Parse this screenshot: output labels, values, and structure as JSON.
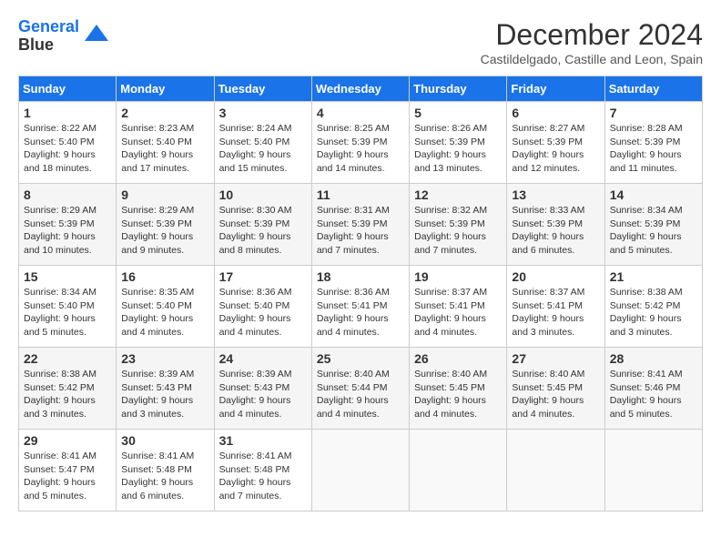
{
  "header": {
    "logo_line1": "General",
    "logo_line2": "Blue",
    "month_title": "December 2024",
    "location": "Castildelgado, Castille and Leon, Spain"
  },
  "weekdays": [
    "Sunday",
    "Monday",
    "Tuesday",
    "Wednesday",
    "Thursday",
    "Friday",
    "Saturday"
  ],
  "weeks": [
    [
      {
        "day": "1",
        "sunrise": "8:22 AM",
        "sunset": "5:40 PM",
        "daylight": "9 hours and 18 minutes."
      },
      {
        "day": "2",
        "sunrise": "8:23 AM",
        "sunset": "5:40 PM",
        "daylight": "9 hours and 17 minutes."
      },
      {
        "day": "3",
        "sunrise": "8:24 AM",
        "sunset": "5:40 PM",
        "daylight": "9 hours and 15 minutes."
      },
      {
        "day": "4",
        "sunrise": "8:25 AM",
        "sunset": "5:39 PM",
        "daylight": "9 hours and 14 minutes."
      },
      {
        "day": "5",
        "sunrise": "8:26 AM",
        "sunset": "5:39 PM",
        "daylight": "9 hours and 13 minutes."
      },
      {
        "day": "6",
        "sunrise": "8:27 AM",
        "sunset": "5:39 PM",
        "daylight": "9 hours and 12 minutes."
      },
      {
        "day": "7",
        "sunrise": "8:28 AM",
        "sunset": "5:39 PM",
        "daylight": "9 hours and 11 minutes."
      }
    ],
    [
      {
        "day": "8",
        "sunrise": "8:29 AM",
        "sunset": "5:39 PM",
        "daylight": "9 hours and 10 minutes."
      },
      {
        "day": "9",
        "sunrise": "8:29 AM",
        "sunset": "5:39 PM",
        "daylight": "9 hours and 9 minutes."
      },
      {
        "day": "10",
        "sunrise": "8:30 AM",
        "sunset": "5:39 PM",
        "daylight": "9 hours and 8 minutes."
      },
      {
        "day": "11",
        "sunrise": "8:31 AM",
        "sunset": "5:39 PM",
        "daylight": "9 hours and 7 minutes."
      },
      {
        "day": "12",
        "sunrise": "8:32 AM",
        "sunset": "5:39 PM",
        "daylight": "9 hours and 7 minutes."
      },
      {
        "day": "13",
        "sunrise": "8:33 AM",
        "sunset": "5:39 PM",
        "daylight": "9 hours and 6 minutes."
      },
      {
        "day": "14",
        "sunrise": "8:34 AM",
        "sunset": "5:39 PM",
        "daylight": "9 hours and 5 minutes."
      }
    ],
    [
      {
        "day": "15",
        "sunrise": "8:34 AM",
        "sunset": "5:40 PM",
        "daylight": "9 hours and 5 minutes."
      },
      {
        "day": "16",
        "sunrise": "8:35 AM",
        "sunset": "5:40 PM",
        "daylight": "9 hours and 4 minutes."
      },
      {
        "day": "17",
        "sunrise": "8:36 AM",
        "sunset": "5:40 PM",
        "daylight": "9 hours and 4 minutes."
      },
      {
        "day": "18",
        "sunrise": "8:36 AM",
        "sunset": "5:41 PM",
        "daylight": "9 hours and 4 minutes."
      },
      {
        "day": "19",
        "sunrise": "8:37 AM",
        "sunset": "5:41 PM",
        "daylight": "9 hours and 4 minutes."
      },
      {
        "day": "20",
        "sunrise": "8:37 AM",
        "sunset": "5:41 PM",
        "daylight": "9 hours and 3 minutes."
      },
      {
        "day": "21",
        "sunrise": "8:38 AM",
        "sunset": "5:42 PM",
        "daylight": "9 hours and 3 minutes."
      }
    ],
    [
      {
        "day": "22",
        "sunrise": "8:38 AM",
        "sunset": "5:42 PM",
        "daylight": "9 hours and 3 minutes."
      },
      {
        "day": "23",
        "sunrise": "8:39 AM",
        "sunset": "5:43 PM",
        "daylight": "9 hours and 3 minutes."
      },
      {
        "day": "24",
        "sunrise": "8:39 AM",
        "sunset": "5:43 PM",
        "daylight": "9 hours and 4 minutes."
      },
      {
        "day": "25",
        "sunrise": "8:40 AM",
        "sunset": "5:44 PM",
        "daylight": "9 hours and 4 minutes."
      },
      {
        "day": "26",
        "sunrise": "8:40 AM",
        "sunset": "5:45 PM",
        "daylight": "9 hours and 4 minutes."
      },
      {
        "day": "27",
        "sunrise": "8:40 AM",
        "sunset": "5:45 PM",
        "daylight": "9 hours and 4 minutes."
      },
      {
        "day": "28",
        "sunrise": "8:41 AM",
        "sunset": "5:46 PM",
        "daylight": "9 hours and 5 minutes."
      }
    ],
    [
      {
        "day": "29",
        "sunrise": "8:41 AM",
        "sunset": "5:47 PM",
        "daylight": "9 hours and 5 minutes."
      },
      {
        "day": "30",
        "sunrise": "8:41 AM",
        "sunset": "5:48 PM",
        "daylight": "9 hours and 6 minutes."
      },
      {
        "day": "31",
        "sunrise": "8:41 AM",
        "sunset": "5:48 PM",
        "daylight": "9 hours and 7 minutes."
      },
      null,
      null,
      null,
      null
    ]
  ]
}
